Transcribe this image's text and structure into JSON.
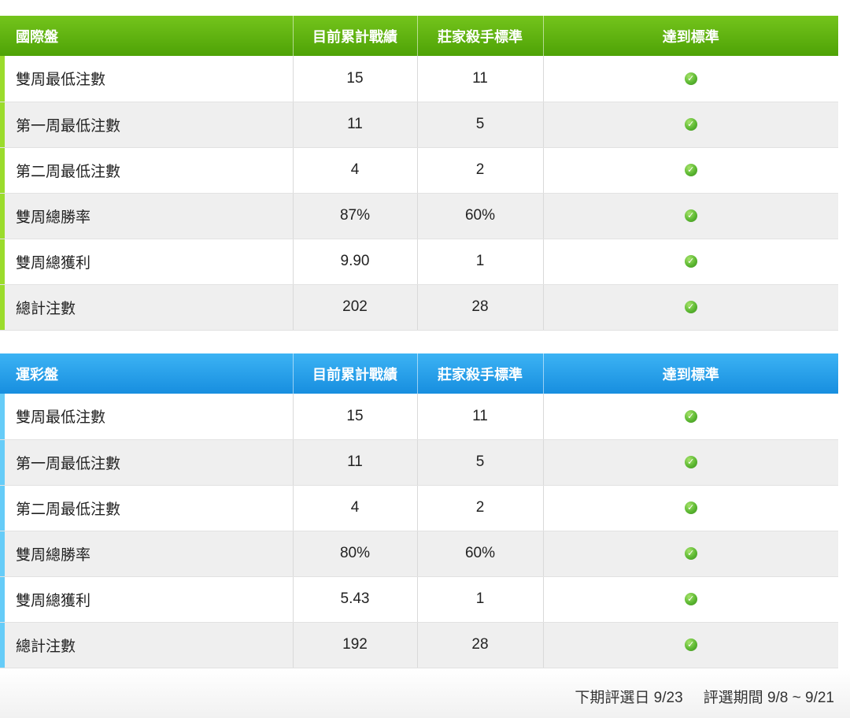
{
  "tables": [
    {
      "id": "intl",
      "title": "國際盤",
      "columns": [
        "目前累計戰績",
        "莊家殺手標準",
        "達到標準"
      ],
      "rows": [
        {
          "label": "雙周最低注數",
          "current": "15",
          "standard": "11",
          "met": true
        },
        {
          "label": "第一周最低注數",
          "current": "11",
          "standard": "5",
          "met": true
        },
        {
          "label": "第二周最低注數",
          "current": "4",
          "standard": "2",
          "met": true
        },
        {
          "label": "雙周總勝率",
          "current": "87%",
          "standard": "60%",
          "met": true
        },
        {
          "label": "雙周總獲利",
          "current": "9.90",
          "standard": "1",
          "met": true
        },
        {
          "label": "總計注數",
          "current": "202",
          "standard": "28",
          "met": true
        }
      ]
    },
    {
      "id": "sport",
      "title": "運彩盤",
      "columns": [
        "目前累計戰績",
        "莊家殺手標準",
        "達到標準"
      ],
      "rows": [
        {
          "label": "雙周最低注數",
          "current": "15",
          "standard": "11",
          "met": true
        },
        {
          "label": "第一周最低注數",
          "current": "11",
          "standard": "5",
          "met": true
        },
        {
          "label": "第二周最低注數",
          "current": "4",
          "standard": "2",
          "met": true
        },
        {
          "label": "雙周總勝率",
          "current": "80%",
          "standard": "60%",
          "met": true
        },
        {
          "label": "雙周總獲利",
          "current": "5.43",
          "standard": "1",
          "met": true
        },
        {
          "label": "總計注數",
          "current": "192",
          "standard": "28",
          "met": true
        }
      ]
    }
  ],
  "footer": {
    "next_selection": "下期評選日 9/23",
    "selection_period": "評選期間 9/8 ~ 9/21"
  },
  "icons": {
    "met": "check-circle-icon"
  },
  "colors": {
    "intl_header": "#5cb010",
    "sport_header": "#2aa2ea",
    "check": "#5cb832"
  }
}
